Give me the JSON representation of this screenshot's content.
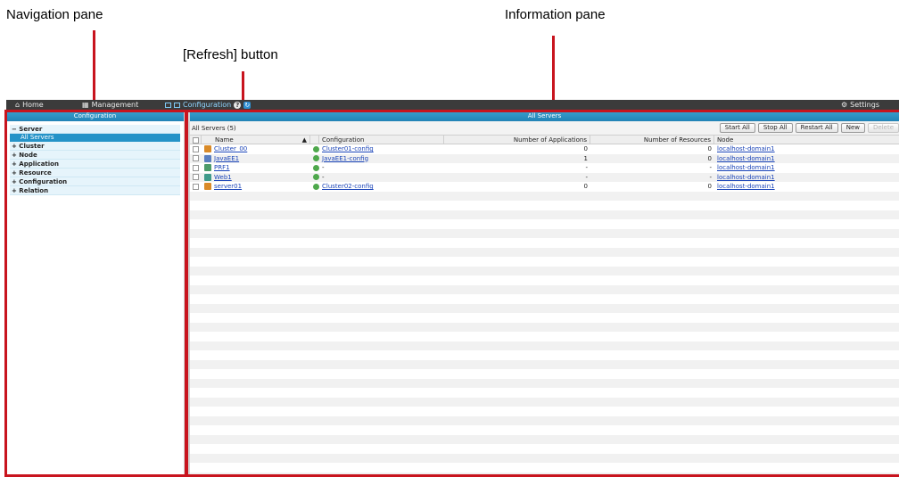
{
  "annotations": {
    "navigation_pane": "Navigation pane",
    "refresh_button": "[Refresh] button",
    "information_pane": "Information pane"
  },
  "topbar": {
    "home": "Home",
    "management": "Management",
    "configuration": "Configuration",
    "settings": "Settings"
  },
  "nav": {
    "header": "Configuration",
    "server": "− Server",
    "all_servers": "All Servers",
    "items": [
      "+ Cluster",
      "+ Node",
      "+ Application",
      "+ Resource",
      "+ Configuration",
      "+ Relation"
    ]
  },
  "info": {
    "header": "All Servers",
    "count_label": "All Servers (5)",
    "buttons": {
      "start_all": "Start All",
      "stop_all": "Stop All",
      "restart_all": "Restart All",
      "new": "New",
      "delete": "Delete"
    },
    "columns": {
      "name": "Name",
      "sort": "▲",
      "configuration": "Configuration",
      "applications": "Number of Applications",
      "resources": "Number of Resources",
      "node": "Node"
    },
    "rows": [
      {
        "name": "Cluster_00",
        "config": "Cluster01-config",
        "apps": "0",
        "resources": "0",
        "node": "localhost-domain1"
      },
      {
        "name": "JavaEE1",
        "config": "JavaEE1-config",
        "apps": "1",
        "resources": "0",
        "node": "localhost-domain1"
      },
      {
        "name": "PRF1",
        "config": "-",
        "apps": "-",
        "resources": "-",
        "node": "localhost-domain1"
      },
      {
        "name": "Web1",
        "config": "-",
        "apps": "-",
        "resources": "-",
        "node": "localhost-domain1"
      },
      {
        "name": "server01",
        "config": "Cluster02-config",
        "apps": "0",
        "resources": "0",
        "node": "localhost-domain1"
      }
    ]
  },
  "colors": {
    "accent": "#2593c8",
    "annotation_red": "#c8141e",
    "topbar": "#3b3b3b"
  }
}
